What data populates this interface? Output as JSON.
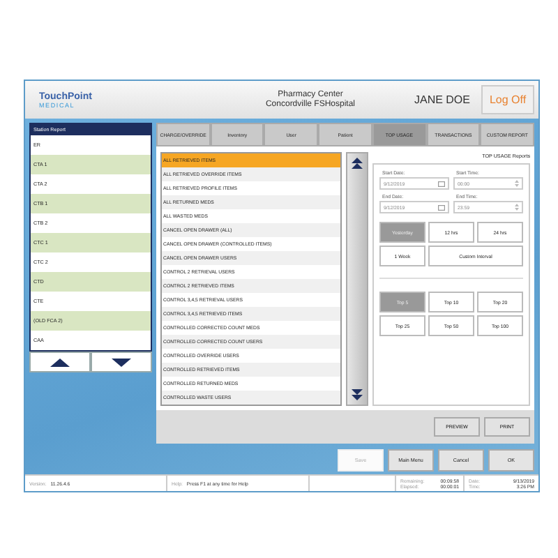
{
  "header": {
    "logo": "TouchPoint",
    "logo_sub": "MEDICAL",
    "title": "Pharmacy Center",
    "subtitle": "Concordville FSHospital",
    "user": "JANE DOE",
    "logoff": "Log Off"
  },
  "stations": {
    "title": "Station Report",
    "items": [
      "ER",
      "CTA 1",
      "CTA 2",
      "CTB 1",
      "CTB 2",
      "CTC 1",
      "CTC 2",
      "CTD",
      "CTE",
      "(OLD FCA 2)",
      "CAA"
    ]
  },
  "tabs": [
    {
      "label": "CHARGE/OVERRIDE",
      "selected": false
    },
    {
      "label": "Inventory",
      "selected": false
    },
    {
      "label": "User",
      "selected": false
    },
    {
      "label": "Patient",
      "selected": false
    },
    {
      "label": "TOP USAGE",
      "selected": true
    },
    {
      "label": "TRANSACTIONS",
      "selected": false
    },
    {
      "label": "CUSTOM REPORT",
      "selected": false
    }
  ],
  "reports": [
    {
      "label": "ALL RETRIEVED ITEMS",
      "selected": true
    },
    {
      "label": "ALL RETRIEVED OVERRIDE ITEMS",
      "selected": false
    },
    {
      "label": "ALL RETRIEVED PROFILE ITEMS",
      "selected": false
    },
    {
      "label": "ALL RETURNED MEDS",
      "selected": false
    },
    {
      "label": "ALL WASTED MEDS",
      "selected": false
    },
    {
      "label": "CANCEL OPEN DRAWER (ALL)",
      "selected": false
    },
    {
      "label": "CANCEL OPEN DRAWER (CONTROLLED ITEMS)",
      "selected": false
    },
    {
      "label": "CANCEL OPEN DRAWER USERS",
      "selected": false
    },
    {
      "label": "CONTROL 2 RETRIEVAL USERS",
      "selected": false
    },
    {
      "label": "CONTROL 2 RETRIEVED ITEMS",
      "selected": false
    },
    {
      "label": "CONTROL 3,4,5 RETRIEVAL USERS",
      "selected": false
    },
    {
      "label": "CONTROL 3,4,5 RETRIEVED ITEMS",
      "selected": false
    },
    {
      "label": "CONTROLLED CORRECTED COUNT MEDS",
      "selected": false
    },
    {
      "label": "CONTROLLED CORRECTED COUNT USERS",
      "selected": false
    },
    {
      "label": "CONTROLLED OVERRIDE USERS",
      "selected": false
    },
    {
      "label": "CONTROLLED RETRIEVED ITEMS",
      "selected": false
    },
    {
      "label": "CONTROLLED RETURNED MEDS",
      "selected": false
    },
    {
      "label": "CONTROLLED WASTE USERS",
      "selected": false
    }
  ],
  "panel": {
    "title": "TOP USAGE Reports",
    "start_date_label": "Start Date:",
    "start_date": "9/12/2019",
    "start_time_label": "Start Time:",
    "start_time": "00:00",
    "end_date_label": "End Date:",
    "end_date": "9/12/2019",
    "end_time_label": "End Time:",
    "end_time": "23:59",
    "ranges": [
      {
        "label": "Yesterday",
        "selected": true
      },
      {
        "label": "12 hrs",
        "selected": false
      },
      {
        "label": "24 hrs",
        "selected": false
      },
      {
        "label": "1 Week",
        "selected": false
      },
      {
        "label": "Custom Interval",
        "selected": false
      }
    ],
    "tops": [
      {
        "label": "Top 5",
        "selected": true
      },
      {
        "label": "Top 10",
        "selected": false
      },
      {
        "label": "Top 20",
        "selected": false
      },
      {
        "label": "Top 25",
        "selected": false
      },
      {
        "label": "Top 50",
        "selected": false
      },
      {
        "label": "Top 100",
        "selected": false
      }
    ]
  },
  "preview": "PREVIEW",
  "print": "PRINT",
  "buttons": [
    {
      "label": "Save",
      "disabled": true
    },
    {
      "label": "Main Menu",
      "disabled": false
    },
    {
      "label": "Cancel",
      "disabled": false
    },
    {
      "label": "OK",
      "disabled": false
    }
  ],
  "status_bar": {
    "version_label": "Version:",
    "version": "11.26.4.6",
    "help_label": "Help:",
    "help": "Press F1 at any time for Help",
    "remaining_label": "Remaining:",
    "remaining": "00:09:58",
    "elapsed_label": "Elapsed:",
    "elapsed": "00:00:01",
    "date_label": "Date:",
    "date": "9/13/2019",
    "time_label": "Time:",
    "time": "3:26 PM"
  }
}
